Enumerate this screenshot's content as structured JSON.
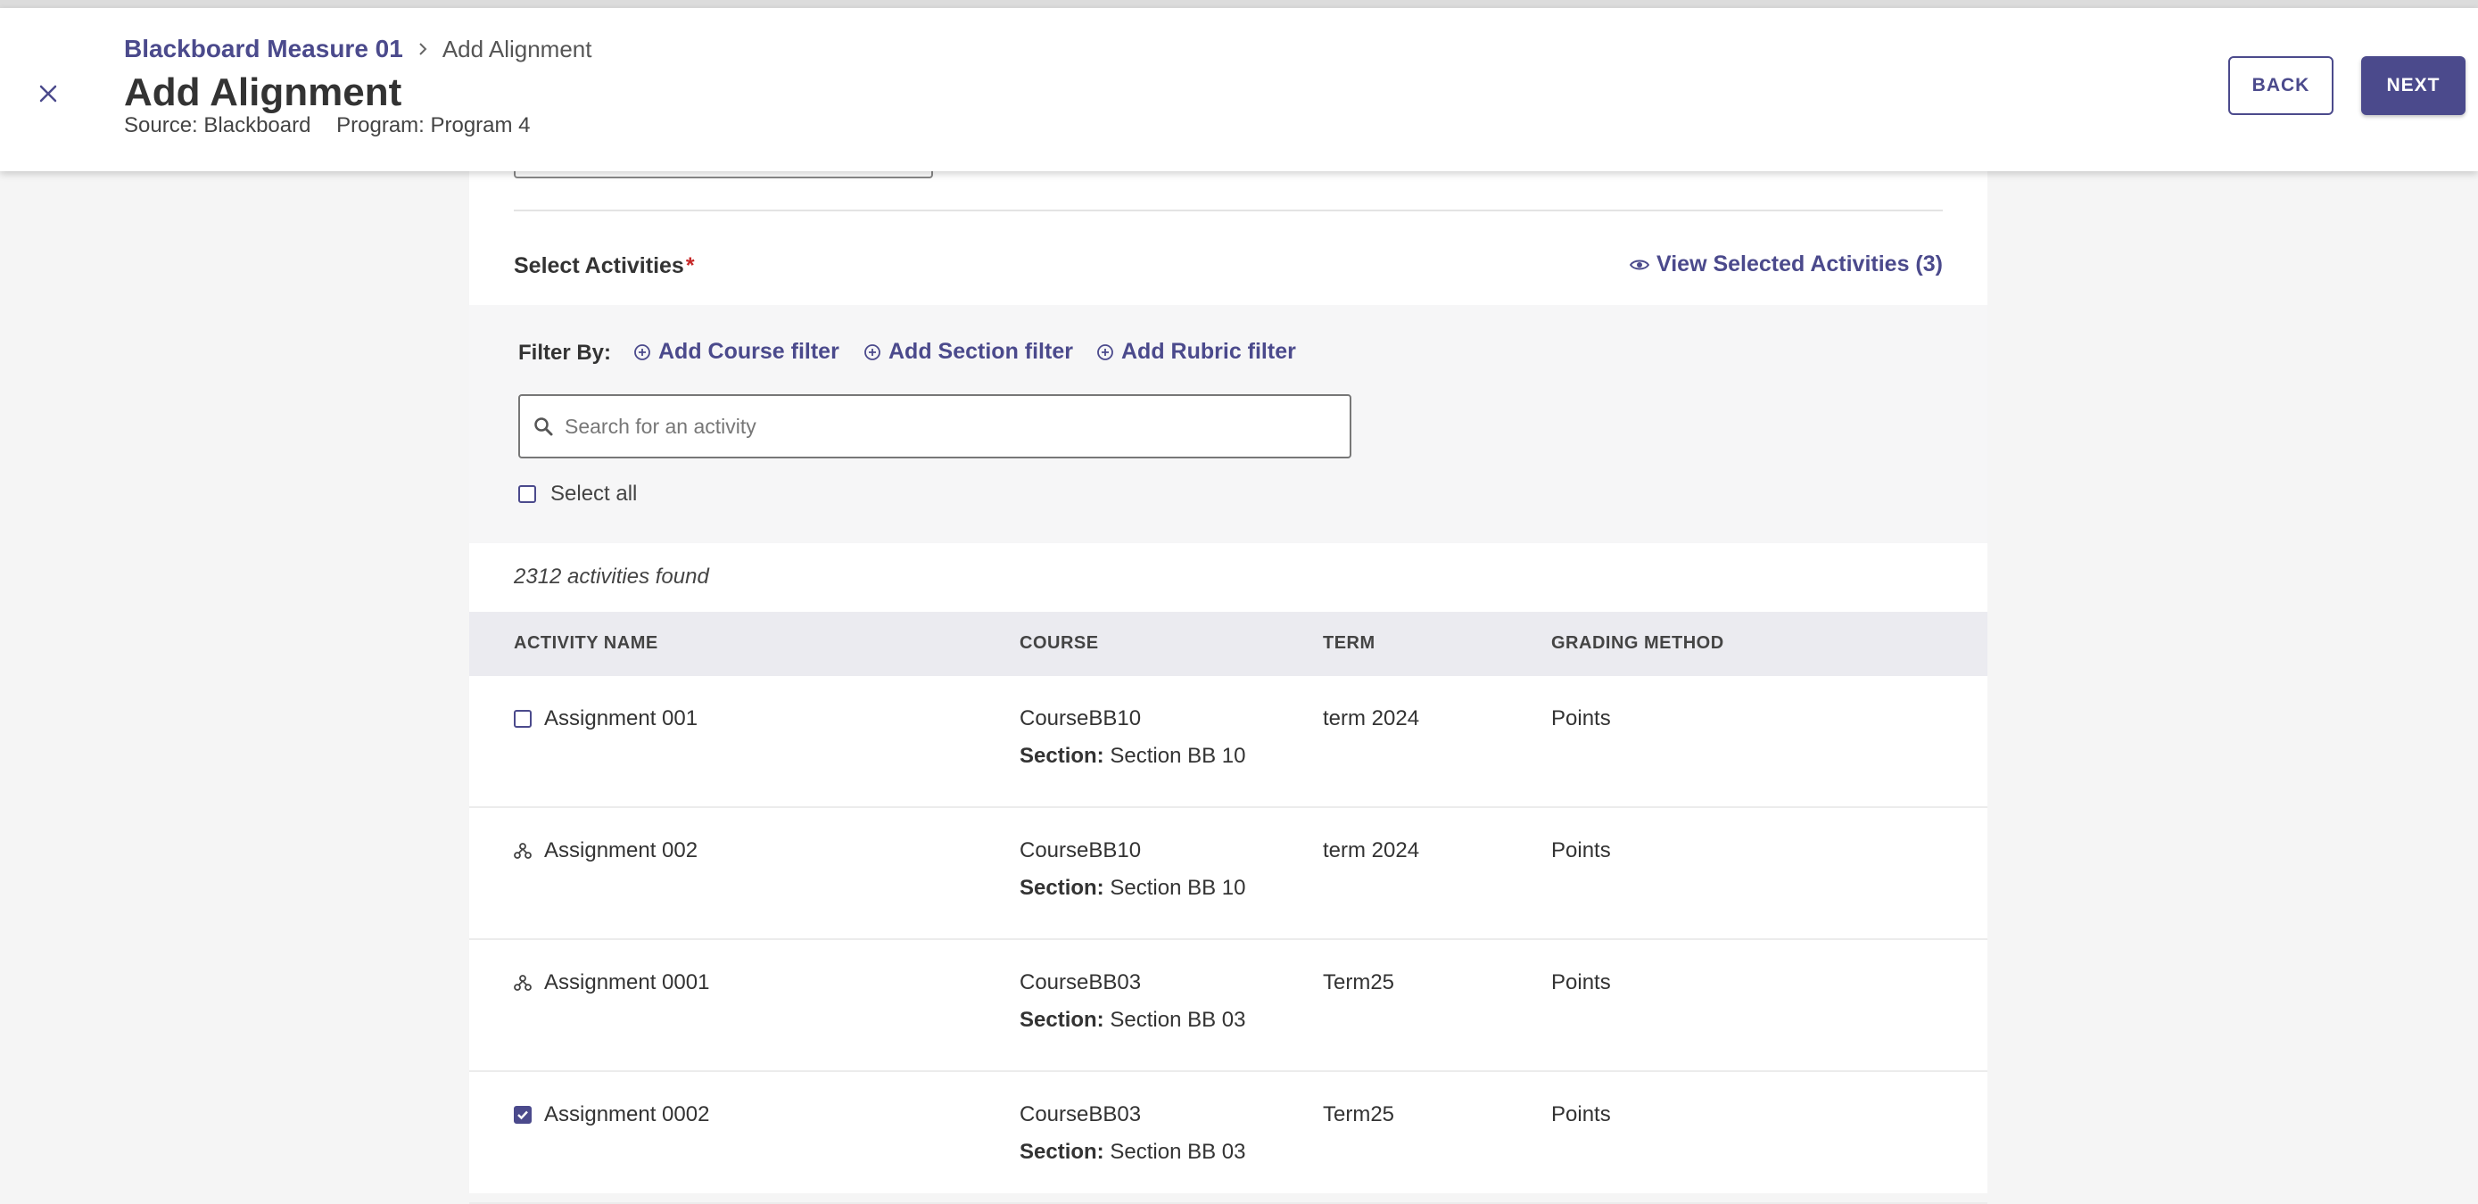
{
  "header": {
    "breadcrumb_parent": "Blackboard Measure 01",
    "breadcrumb_current": "Add Alignment",
    "title": "Add Alignment",
    "source": "Source: Blackboard",
    "program": "Program: Program 4",
    "back_label": "BACK",
    "next_label": "NEXT"
  },
  "activities": {
    "label": "Select Activities",
    "required_mark": "*",
    "view_selected_label": "View Selected Activities (3)"
  },
  "filters": {
    "filter_by_label": "Filter By:",
    "course_filter": "Add Course filter",
    "section_filter": "Add Section filter",
    "rubric_filter": "Add Rubric filter",
    "search_placeholder": "Search for an activity",
    "select_all_label": "Select all"
  },
  "results": {
    "count_text": "2312 activities found"
  },
  "table": {
    "columns": [
      "ACTIVITY NAME",
      "COURSE",
      "TERM",
      "GRADING METHOD"
    ],
    "section_prefix": "Section:",
    "rows": [
      {
        "name": "Assignment 001",
        "course": "CourseBB10",
        "section": "Section BB 10",
        "term": "term 2024",
        "grading": "Points",
        "state": "unchecked"
      },
      {
        "name": "Assignment 002",
        "course": "CourseBB10",
        "section": "Section BB 10",
        "term": "term 2024",
        "grading": "Points",
        "state": "hierarchy"
      },
      {
        "name": "Assignment 0001",
        "course": "CourseBB03",
        "section": "Section BB 03",
        "term": "Term25",
        "grading": "Points",
        "state": "hierarchy"
      },
      {
        "name": "Assignment 0002",
        "course": "CourseBB03",
        "section": "Section BB 03",
        "term": "Term25",
        "grading": "Points",
        "state": "checked"
      }
    ]
  },
  "colors": {
    "accent": "#4b4a8c",
    "required": "#c62828"
  },
  "icons": [
    "close-icon",
    "chevron-right-icon",
    "eye-icon",
    "add-circle-icon",
    "search-icon",
    "hierarchy-icon"
  ]
}
